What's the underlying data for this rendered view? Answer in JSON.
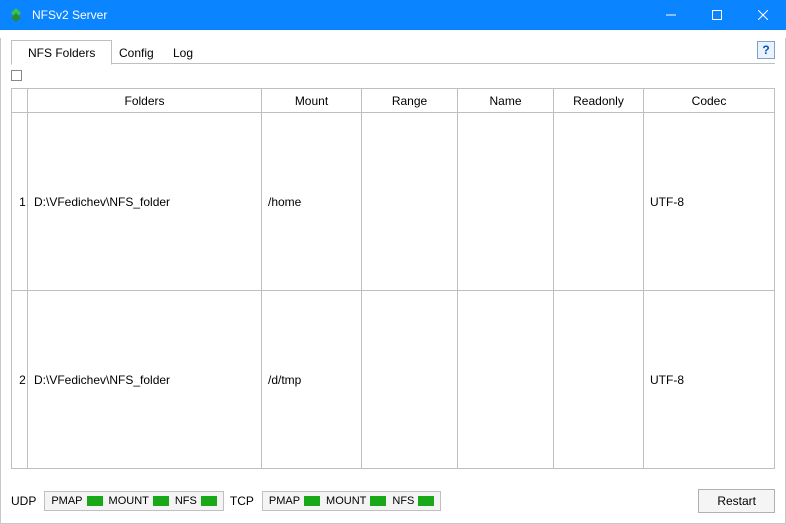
{
  "window": {
    "title": "NFSv2 Server"
  },
  "tabs": [
    {
      "label": "NFS Folders",
      "active": true
    },
    {
      "label": "Config",
      "active": false
    },
    {
      "label": "Log",
      "active": false
    }
  ],
  "help_label": "?",
  "table": {
    "columns": {
      "folders": "Folders",
      "mount": "Mount",
      "range": "Range",
      "name": "Name",
      "readonly": "Readonly",
      "codec": "Codec"
    },
    "rows": [
      {
        "num": "1",
        "folders": "D:\\VFedichev\\NFS_folder",
        "mount": "/home",
        "range": "",
        "name": "",
        "readonly": "",
        "codec": "UTF-8"
      },
      {
        "num": "2",
        "folders": "D:\\VFedichev\\NFS_folder",
        "mount": "/d/tmp",
        "range": "",
        "name": "",
        "readonly": "",
        "codec": "UTF-8"
      }
    ]
  },
  "status": {
    "udp_label": "UDP",
    "tcp_label": "TCP",
    "svc_pmap": "PMAP",
    "svc_mount": "MOUNT",
    "svc_nfs": "NFS",
    "restart_label": "Restart"
  },
  "colors": {
    "titlebar": "#0a84ff",
    "led_on": "#18a818"
  }
}
